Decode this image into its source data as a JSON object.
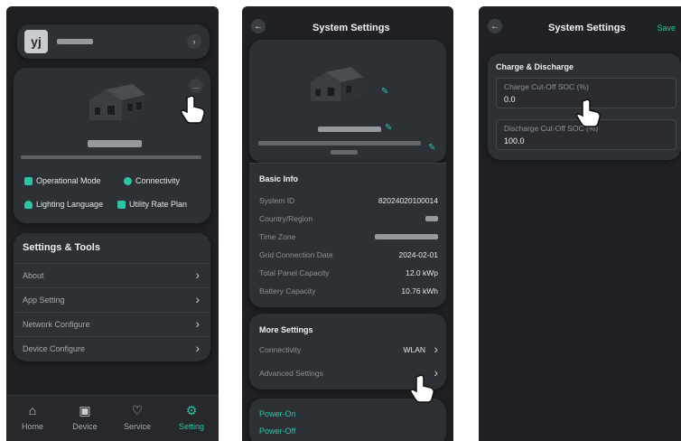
{
  "screen1": {
    "avatar_initials": "yj",
    "legend": [
      {
        "label": "Operational Mode",
        "icon": "flag-icon"
      },
      {
        "label": "Connectivity",
        "icon": "connectivity-icon"
      },
      {
        "label": "Lighting Language",
        "icon": "bulb-icon"
      },
      {
        "label": "Utility Rate Plan",
        "icon": "tag-icon"
      }
    ],
    "tools": {
      "title": "Settings & Tools",
      "items": [
        "About",
        "App Setting",
        "Network Configure",
        "Device Configure"
      ]
    },
    "tabs": [
      {
        "label": "Home",
        "icon": "home-icon"
      },
      {
        "label": "Device",
        "icon": "device-icon"
      },
      {
        "label": "Service",
        "icon": "service-icon"
      },
      {
        "label": "Setting",
        "icon": "gear-icon",
        "active": true
      }
    ],
    "more_label": "..."
  },
  "screen2": {
    "title": "System Settings",
    "basic_info": {
      "title": "Basic Info",
      "rows": [
        {
          "key": "System ID",
          "value": "82024020100014"
        },
        {
          "key": "Country/Region",
          "value": ""
        },
        {
          "key": "Time Zone",
          "value": ""
        },
        {
          "key": "Grid Connection Date",
          "value": "2024-02-01"
        },
        {
          "key": "Total Panel Capacity",
          "value": "12.0 kWp"
        },
        {
          "key": "Battery Capacity",
          "value": "10.76 kWh"
        }
      ]
    },
    "more_settings": {
      "title": "More Settings",
      "connectivity_label": "Connectivity",
      "connectivity_value": "WLAN",
      "advanced_label": "Advanced Settings"
    },
    "power_on": "Power-On",
    "power_off": "Power-Off"
  },
  "screen3": {
    "title": "System Settings",
    "save_label": "Save",
    "section_title": "Charge & Discharge",
    "charge_cutoff_label": "Charge Cut-Off SOC (%)",
    "charge_cutoff_value": "0.0",
    "discharge_cutoff_label": "Discharge Cut-Off SOC (%)",
    "discharge_cutoff_value": "100.0"
  },
  "colors": {
    "accent": "#2fc3a6",
    "background": "#1f2124",
    "card": "#2d3034"
  }
}
